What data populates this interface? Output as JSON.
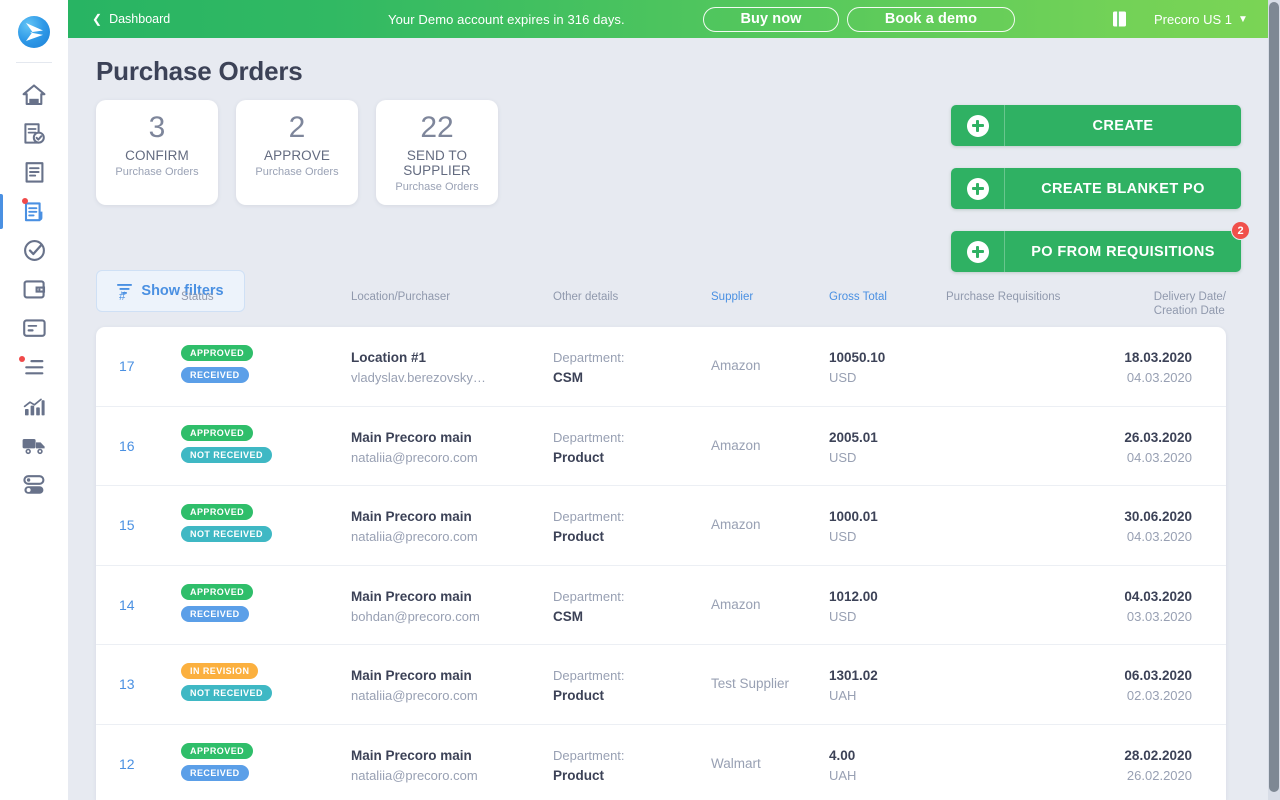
{
  "sidebar": {
    "logo": "precoro-logo",
    "items": [
      {
        "name": "home",
        "icon": "home-icon",
        "active": false,
        "dot": false
      },
      {
        "name": "requisitions",
        "icon": "document-check-icon",
        "active": false,
        "dot": false
      },
      {
        "name": "rfp",
        "icon": "document-lines-icon",
        "active": false,
        "dot": false
      },
      {
        "name": "purchase-orders",
        "icon": "document-order-icon",
        "active": true,
        "dot": true
      },
      {
        "name": "receipts",
        "icon": "check-circle-icon",
        "active": false,
        "dot": false
      },
      {
        "name": "expenses",
        "icon": "wallet-icon",
        "active": false,
        "dot": false
      },
      {
        "name": "invoices",
        "icon": "card-icon",
        "active": false,
        "dot": false
      },
      {
        "name": "lists",
        "icon": "list-icon",
        "active": false,
        "dot": true
      },
      {
        "name": "reports",
        "icon": "chart-bar-icon",
        "active": false,
        "dot": false
      },
      {
        "name": "suppliers",
        "icon": "truck-icon",
        "active": false,
        "dot": false
      },
      {
        "name": "settings",
        "icon": "toggle-icon",
        "active": false,
        "dot": false
      }
    ]
  },
  "topbar": {
    "back_label": "Dashboard",
    "back_icon": "chevron-left-icon",
    "expiry_text": "Your Demo account expires in 316 days.",
    "buy_now_label": "Buy now",
    "book_demo_label": "Book a demo",
    "book_icon": "book-icon",
    "company_label": "Precoro US 1",
    "caret_icon": "chevron-down-icon",
    "user_icon": "user-settings-icon",
    "gradient_from": "#28b463",
    "gradient_to": "#7ad455"
  },
  "page": {
    "title": "Purchase Orders"
  },
  "stats": [
    {
      "count": "3",
      "action": "CONFIRM",
      "subtitle": "Purchase Orders"
    },
    {
      "count": "2",
      "action": "APPROVE",
      "subtitle": "Purchase Orders"
    },
    {
      "count": "22",
      "action": "SEND TO SUPPLIER",
      "subtitle": "Purchase Orders"
    }
  ],
  "filters": {
    "label": "Show filters",
    "icon": "filter-icon",
    "accent": "#4a90e2"
  },
  "actions": [
    {
      "id": "create",
      "label": "CREATE",
      "icon": "plus-icon",
      "badge": null
    },
    {
      "id": "blanket",
      "label": "CREATE BLANKET PO",
      "icon": "plus-icon",
      "badge": null
    },
    {
      "id": "requisitions",
      "label": "PO FROM REQUISITIONS",
      "icon": "plus-icon",
      "badge": "2"
    }
  ],
  "table": {
    "columns": [
      {
        "key": "num",
        "label": "#",
        "sortable": true
      },
      {
        "key": "status",
        "label": "Status",
        "sortable": false
      },
      {
        "key": "loc",
        "label": "Location/Purchaser",
        "sortable": false
      },
      {
        "key": "other",
        "label": "Other details",
        "sortable": false
      },
      {
        "key": "supp",
        "label": "Supplier",
        "sortable": true
      },
      {
        "key": "total",
        "label": "Gross Total",
        "sortable": true
      },
      {
        "key": "req",
        "label": "Purchase Requisitions",
        "sortable": false
      },
      {
        "key": "dates",
        "label": "Delivery Date/\nCreation Date",
        "sortable": false
      }
    ],
    "rows": [
      {
        "num": "17",
        "badges": [
          {
            "text": "APPROVED",
            "kind": "approved"
          },
          {
            "text": "RECEIVED",
            "kind": "received"
          }
        ],
        "location": "Location #1",
        "purchaser": "vladyslav.berezovsky…",
        "other_label": "Department:",
        "other_value": "CSM",
        "supplier": "Amazon",
        "total": "10050.10",
        "currency": "USD",
        "requisitions": "",
        "delivery_date": "18.03.2020",
        "creation_date": "04.03.2020"
      },
      {
        "num": "16",
        "badges": [
          {
            "text": "APPROVED",
            "kind": "approved"
          },
          {
            "text": "NOT RECEIVED",
            "kind": "notreceived"
          }
        ],
        "location": "Main Precoro main",
        "purchaser": "nataliia@precoro.com",
        "other_label": "Department:",
        "other_value": "Product",
        "supplier": "Amazon",
        "total": "2005.01",
        "currency": "USD",
        "requisitions": "",
        "delivery_date": "26.03.2020",
        "creation_date": "04.03.2020"
      },
      {
        "num": "15",
        "badges": [
          {
            "text": "APPROVED",
            "kind": "approved"
          },
          {
            "text": "NOT RECEIVED",
            "kind": "notreceived"
          }
        ],
        "location": "Main Precoro main",
        "purchaser": "nataliia@precoro.com",
        "other_label": "Department:",
        "other_value": "Product",
        "supplier": "Amazon",
        "total": "1000.01",
        "currency": "USD",
        "requisitions": "",
        "delivery_date": "30.06.2020",
        "creation_date": "04.03.2020"
      },
      {
        "num": "14",
        "badges": [
          {
            "text": "APPROVED",
            "kind": "approved"
          },
          {
            "text": "RECEIVED",
            "kind": "received"
          }
        ],
        "location": "Main Precoro main",
        "purchaser": "bohdan@precoro.com",
        "other_label": "Department:",
        "other_value": "CSM",
        "supplier": "Amazon",
        "total": "1012.00",
        "currency": "USD",
        "requisitions": "",
        "delivery_date": "04.03.2020",
        "creation_date": "03.03.2020"
      },
      {
        "num": "13",
        "badges": [
          {
            "text": "IN REVISION",
            "kind": "inrevision"
          },
          {
            "text": "NOT RECEIVED",
            "kind": "notreceived"
          }
        ],
        "location": "Main Precoro main",
        "purchaser": "nataliia@precoro.com",
        "other_label": "Department:",
        "other_value": "Product",
        "supplier": "Test Supplier",
        "total": "1301.02",
        "currency": "UAH",
        "requisitions": "",
        "delivery_date": "06.03.2020",
        "creation_date": "02.03.2020"
      },
      {
        "num": "12",
        "badges": [
          {
            "text": "APPROVED",
            "kind": "approved"
          },
          {
            "text": "RECEIVED",
            "kind": "received"
          }
        ],
        "location": "Main Precoro main",
        "purchaser": "nataliia@precoro.com",
        "other_label": "Department:",
        "other_value": "Product",
        "supplier": "Walmart",
        "total": "4.00",
        "currency": "UAH",
        "requisitions": "",
        "delivery_date": "28.02.2020",
        "creation_date": "26.02.2020"
      }
    ]
  }
}
